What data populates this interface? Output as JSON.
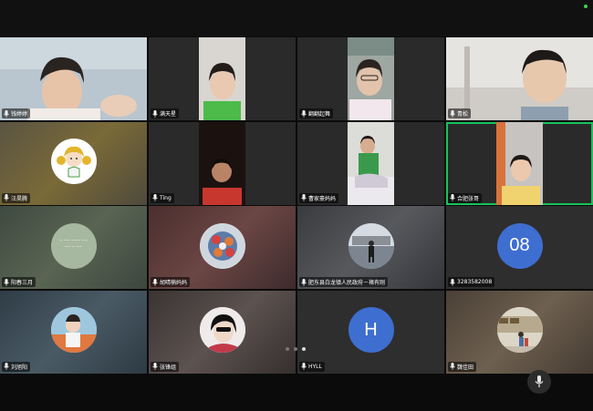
{
  "participants": [
    {
      "name": "钱婷婷"
    },
    {
      "name": "满天星"
    },
    {
      "name": "翻翻起舞"
    },
    {
      "name": "青松"
    },
    {
      "name": "汪昊腾"
    },
    {
      "name": "Ting"
    },
    {
      "name": "曹家豪妈妈"
    },
    {
      "name": "合肥张哥"
    },
    {
      "name": "阳春三月"
    },
    {
      "name": "胡晴楠妈妈"
    },
    {
      "name": "肥东县白龙镇人民政府－褚有刚"
    },
    {
      "name": "3283582008"
    },
    {
      "name": "刘旭阳"
    },
    {
      "name": "张锋组"
    },
    {
      "name": "HYLL"
    },
    {
      "name": "魏佳田"
    }
  ],
  "avatars": {
    "tile12_initials": "08",
    "tile15_initial": "H"
  },
  "pagination": {
    "total": 3,
    "current": 3
  },
  "colors": {
    "active_border": "#16c35c",
    "letter_avatar": "#3e6ed0",
    "background": "#0b0b0b"
  },
  "icons": {
    "mic": "microphone-icon",
    "bottom_control": "microphone-icon"
  }
}
